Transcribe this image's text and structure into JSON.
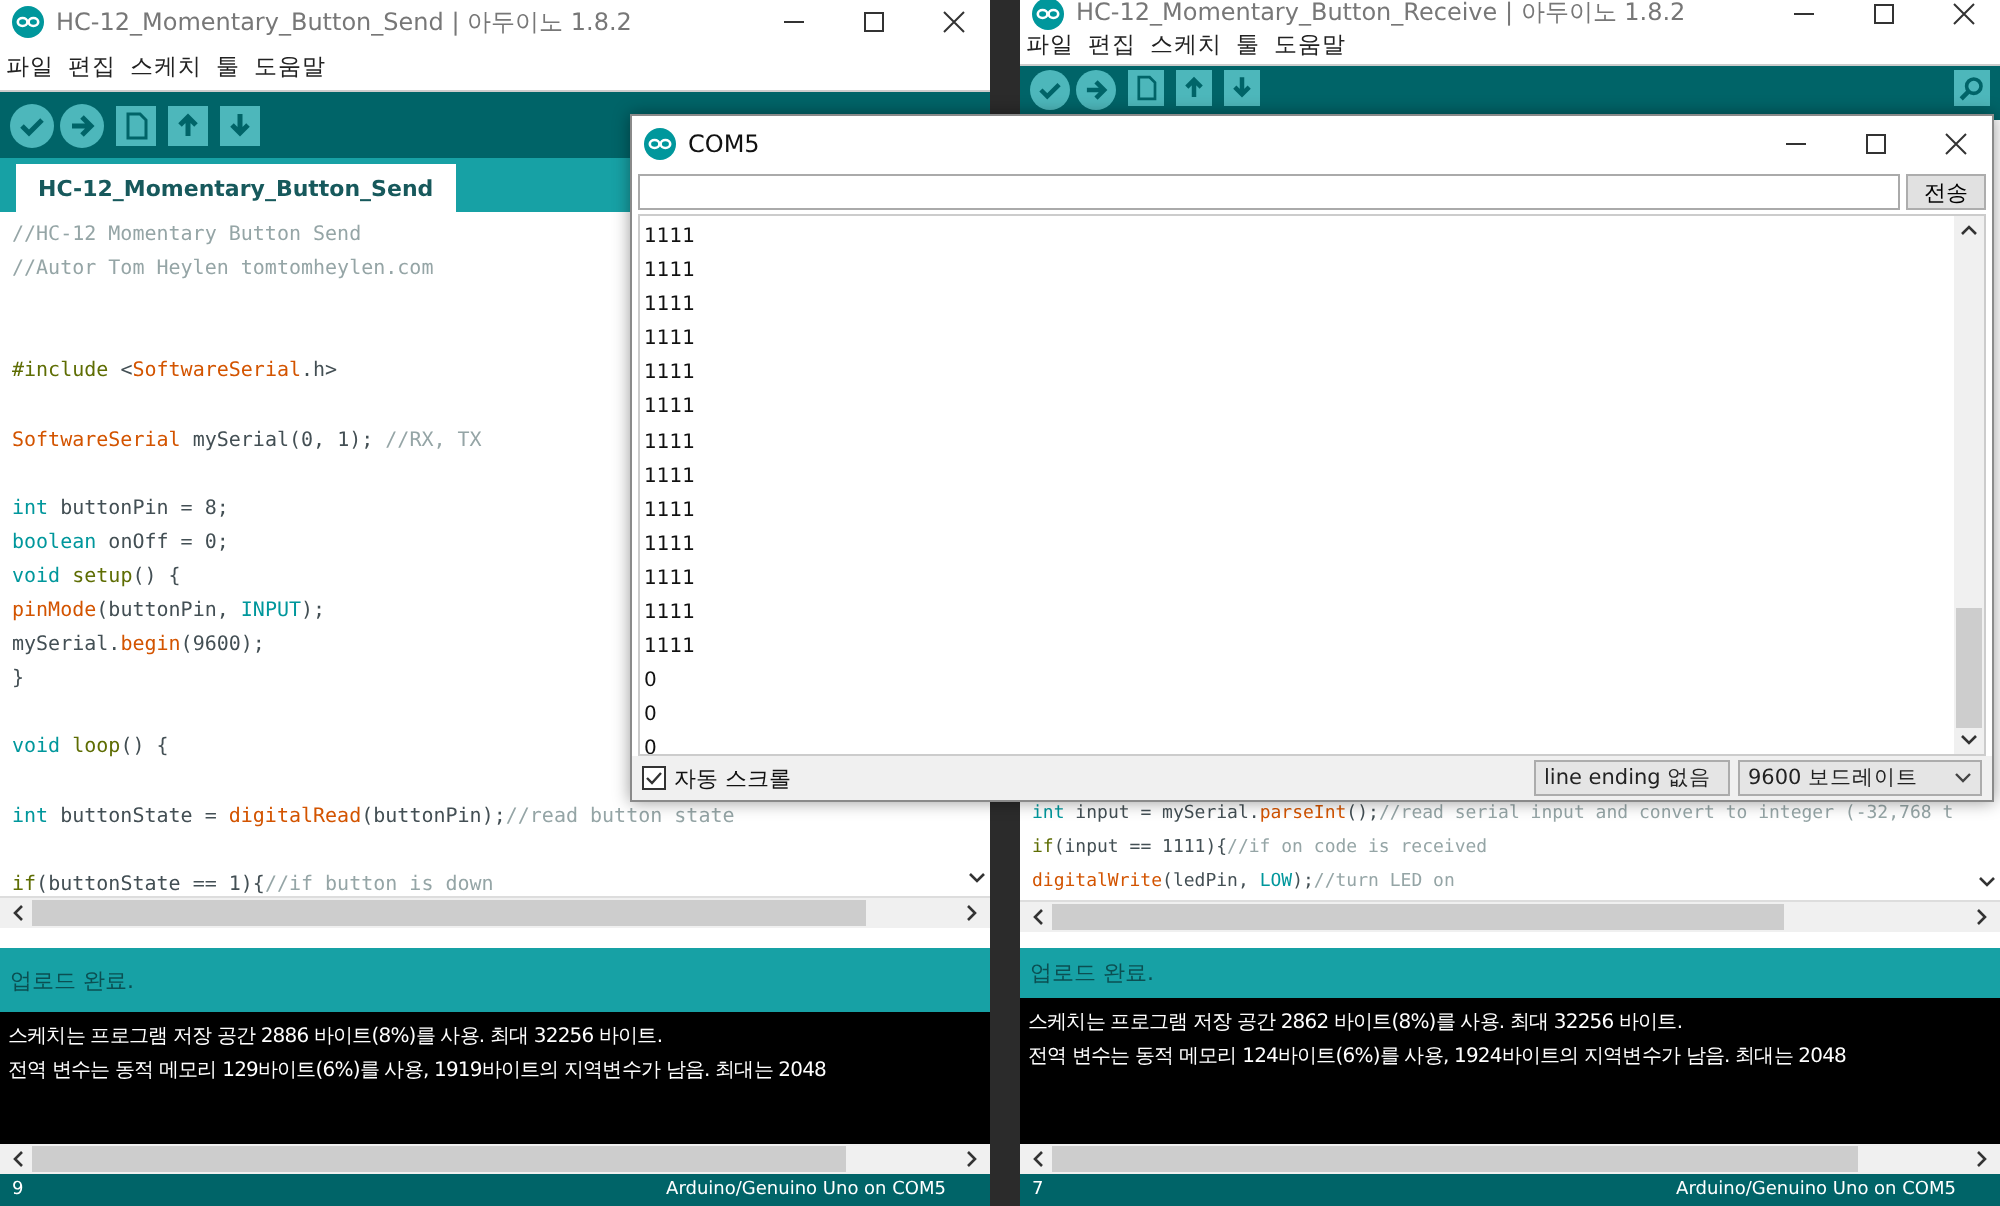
{
  "left_window": {
    "title": "HC-12_Momentary_Button_Send | 아두이노 1.8.2",
    "menu": [
      "파일",
      "편집",
      "스케치",
      "툴",
      "도움말"
    ],
    "tab": {
      "label": "HC-12_Momentary_Button_Send",
      "selected": true
    },
    "code": [
      {
        "kind": "code",
        "segments": [
          {
            "text": "//HC-12 Momentary Button Send",
            "kind": "comment"
          }
        ]
      },
      {
        "kind": "code",
        "segments": [
          {
            "text": "//Autor Tom Heylen tomtomheylen.com",
            "kind": "comment"
          }
        ]
      },
      {
        "kind": "blank"
      },
      {
        "kind": "blank"
      },
      {
        "kind": "code",
        "segments": [
          {
            "text": "#include",
            "kind": "preproc"
          },
          {
            "text": " <",
            "kind": "plain"
          },
          {
            "text": "SoftwareSerial",
            "kind": "function"
          },
          {
            "text": ".h>",
            "kind": "plain"
          }
        ]
      },
      {
        "kind": "blank"
      },
      {
        "kind": "code",
        "segments": [
          {
            "text": "SoftwareSerial",
            "kind": "function"
          },
          {
            "text": " mySerial(0, 1); ",
            "kind": "plain"
          },
          {
            "text": "//RX, TX",
            "kind": "comment"
          }
        ]
      },
      {
        "kind": "blank"
      },
      {
        "kind": "code",
        "segments": [
          {
            "text": "int",
            "kind": "keyword"
          },
          {
            "text": " buttonPin = 8;",
            "kind": "plain"
          }
        ]
      },
      {
        "kind": "code",
        "segments": [
          {
            "text": "boolean",
            "kind": "keyword"
          },
          {
            "text": " onOff = 0;",
            "kind": "plain"
          }
        ]
      },
      {
        "kind": "code",
        "segments": [
          {
            "text": "void ",
            "kind": "keyword"
          },
          {
            "text": "setup",
            "kind": "ident"
          },
          {
            "text": "() {",
            "kind": "plain"
          }
        ]
      },
      {
        "kind": "code",
        "segments": [
          {
            "text": "pinMode",
            "kind": "function"
          },
          {
            "text": "(buttonPin, ",
            "kind": "plain"
          },
          {
            "text": "INPUT",
            "kind": "keyword"
          },
          {
            "text": ");",
            "kind": "plain"
          }
        ]
      },
      {
        "kind": "code",
        "segments": [
          {
            "text": "mySerial.",
            "kind": "plain"
          },
          {
            "text": "begin",
            "kind": "function"
          },
          {
            "text": "(9600);",
            "kind": "plain"
          }
        ]
      },
      {
        "kind": "code",
        "segments": [
          {
            "text": "}",
            "kind": "plain"
          }
        ]
      },
      {
        "kind": "blank"
      },
      {
        "kind": "code",
        "segments": [
          {
            "text": "void ",
            "kind": "keyword"
          },
          {
            "text": "loop",
            "kind": "ident"
          },
          {
            "text": "() {",
            "kind": "plain"
          }
        ]
      },
      {
        "kind": "blank"
      },
      {
        "kind": "code",
        "segments": [
          {
            "text": "int",
            "kind": "keyword"
          },
          {
            "text": " buttonState = ",
            "kind": "plain"
          },
          {
            "text": "digitalRead",
            "kind": "function"
          },
          {
            "text": "(buttonPin);",
            "kind": "plain"
          },
          {
            "text": "//read button state",
            "kind": "comment"
          }
        ]
      },
      {
        "kind": "blank"
      },
      {
        "kind": "code",
        "segments": [
          {
            "text": "if",
            "kind": "ident"
          },
          {
            "text": "(buttonState == 1){",
            "kind": "plain"
          },
          {
            "text": "//if button is down",
            "kind": "comment"
          }
        ]
      }
    ],
    "message": "업로드 완료.",
    "console": [
      "스케치는 프로그램 저장 공간 2886 바이트(8%)를 사용. 최대 32256 바이트.",
      "전역 변수는 동적 메모리 129바이트(6%)를 사용, 1919바이트의 지역변수가 남음.  최대는 2048"
    ],
    "line_number": "9",
    "board": "Arduino/Genuino Uno on COM5"
  },
  "right_window": {
    "title": "HC-12_Momentary_Button_Receive | 아두이노 1.8.2",
    "menu": [
      "파일",
      "편집",
      "스케치",
      "툴",
      "도움말"
    ],
    "code": [
      {
        "kind": "code",
        "segments": [
          {
            "text": "int",
            "kind": "keyword"
          },
          {
            "text": " input = mySerial.",
            "kind": "plain"
          },
          {
            "text": "parseInt",
            "kind": "function"
          },
          {
            "text": "();",
            "kind": "plain"
          },
          {
            "text": "//read serial input and convert to integer (-32,768 t",
            "kind": "comment"
          }
        ]
      },
      {
        "kind": "code",
        "segments": [
          {
            "text": "if",
            "kind": "ident"
          },
          {
            "text": "(input == 1111){",
            "kind": "plain"
          },
          {
            "text": "//if on code is received",
            "kind": "comment"
          }
        ]
      },
      {
        "kind": "code",
        "segments": [
          {
            "text": "digitalWrite",
            "kind": "function"
          },
          {
            "text": "(ledPin, ",
            "kind": "plain"
          },
          {
            "text": "LOW",
            "kind": "keyword"
          },
          {
            "text": ");",
            "kind": "plain"
          },
          {
            "text": "//turn LED on",
            "kind": "comment"
          }
        ]
      }
    ],
    "message": "업로드 완료.",
    "console": [
      "스케치는 프로그램 저장 공간 2862 바이트(8%)를 사용. 최대 32256 바이트.",
      "전역 변수는 동적 메모리 124바이트(6%)를 사용, 1924바이트의 지역변수가 남음.  최대는 2048"
    ],
    "line_number": "7",
    "board": "Arduino/Genuino Uno on COM5"
  },
  "serial_monitor": {
    "title": "COM5",
    "send_button": "전송",
    "output": [
      "1111",
      "1111",
      "1111",
      "1111",
      "1111",
      "1111",
      "1111",
      "1111",
      "1111",
      "1111",
      "1111",
      "1111",
      "1111",
      "0",
      "0",
      "0"
    ],
    "autoscroll": {
      "label": "자동 스크롤",
      "checked": true
    },
    "line_ending": "line ending 없음",
    "baud_rate": "9600 보드레이트"
  }
}
